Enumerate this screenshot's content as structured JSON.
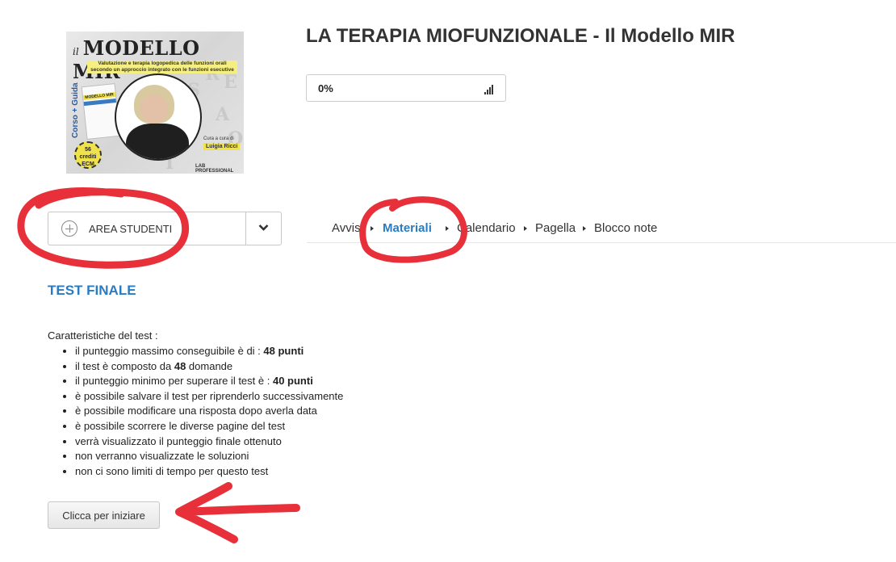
{
  "course": {
    "title": "LA TERAPIA MIOFUNZIONALE - Il Modello MIR",
    "progress_label": "0%",
    "cover": {
      "brand_prefix": "il",
      "brand_name": "MODELLO MIR",
      "brand_mark": "®",
      "subtitle": "Valutazione e terapia logopedica delle funzioni orali secondo un approccio integrato con le funzioni esecutive",
      "side_text": "Corso + Guida",
      "book_title": "MODELLO MIR",
      "badge": "56 crediti ECM",
      "author_prefix": "Cura a cura di",
      "author_name": "Luigia Ricci",
      "publisher": "LAB PROFESSIONAL"
    }
  },
  "area_studenti": {
    "label": "AREA STUDENTI"
  },
  "tabs": [
    {
      "label": "Avvisi",
      "active": false
    },
    {
      "label": "Materiali",
      "active": true
    },
    {
      "label": "Calendario",
      "active": false
    },
    {
      "label": "Pagella",
      "active": false
    },
    {
      "label": "Blocco note",
      "active": false
    }
  ],
  "test": {
    "title": "TEST FINALE",
    "intro": "Caratteristiche del test :",
    "features": [
      {
        "text": "il punteggio massimo conseguibile è di : ",
        "bold": "48 punti",
        "after": ""
      },
      {
        "text": "il test è composto da ",
        "bold": "48",
        "after": " domande"
      },
      {
        "text": "il punteggio minimo per superare il test è : ",
        "bold": "40 punti",
        "after": ""
      },
      {
        "text": "è possibile salvare il test per riprenderlo successivamente",
        "bold": "",
        "after": ""
      },
      {
        "text": "è possibile modificare una risposta dopo averla data",
        "bold": "",
        "after": ""
      },
      {
        "text": "è possibile scorrere le diverse pagine del test",
        "bold": "",
        "after": ""
      },
      {
        "text": "verrà visualizzato il punteggio finale ottenuto",
        "bold": "",
        "after": ""
      },
      {
        "text": "non verranno visualizzate le soluzioni",
        "bold": "",
        "after": ""
      },
      {
        "text": "non ci sono limiti di tempo per questo test",
        "bold": "",
        "after": ""
      }
    ],
    "start_button": "Clicca per iniziare"
  },
  "colors": {
    "accent": "#2a7bbf",
    "annotation": "#e8303a"
  },
  "icons": {
    "progress": "signal-bars-icon",
    "area": "plus-circle-icon",
    "dropdown": "chevron-down-icon",
    "tab_separator": "caret-right-icon"
  }
}
